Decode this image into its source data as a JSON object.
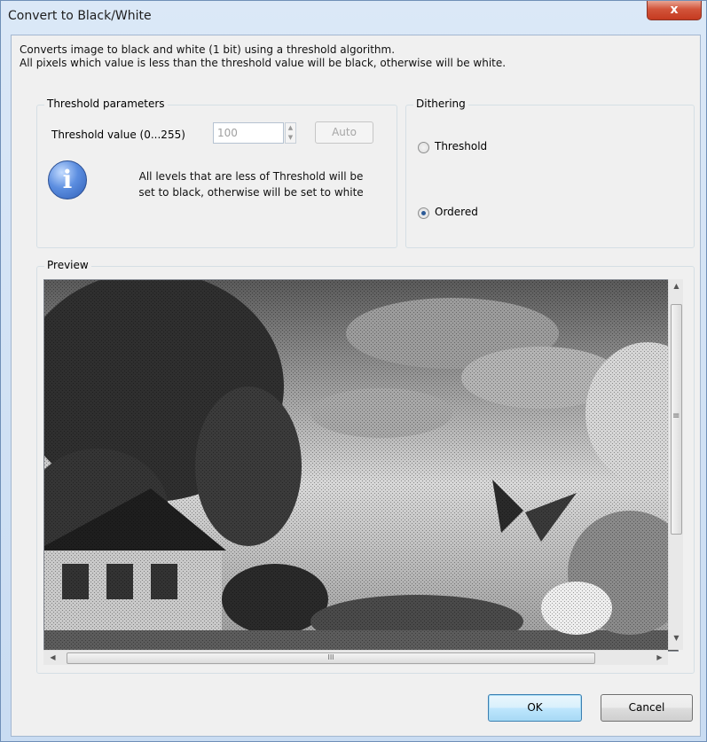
{
  "window": {
    "title": "Convert to Black/White",
    "close_label": "x"
  },
  "description": {
    "line1": "Converts image to black and white (1 bit) using a threshold algorithm.",
    "line2": "All pixels which value is less than the threshold value will be black, otherwise will be white."
  },
  "threshold": {
    "group_label": "Threshold parameters",
    "label": "Threshold value (0...255)",
    "value": "100",
    "auto_label": "Auto",
    "info_icon": "info-icon",
    "info_line1": "All levels that are less of Threshold will be",
    "info_line2": "set to black, otherwise will be set to white"
  },
  "dithering": {
    "group_label": "Dithering",
    "options": [
      {
        "label": "Threshold",
        "selected": false
      },
      {
        "label": "Ordered",
        "selected": true
      }
    ]
  },
  "preview": {
    "label": "Preview",
    "hscroll_grip": "III",
    "vscroll_grip": "≡"
  },
  "buttons": {
    "ok": "OK",
    "cancel": "Cancel"
  }
}
